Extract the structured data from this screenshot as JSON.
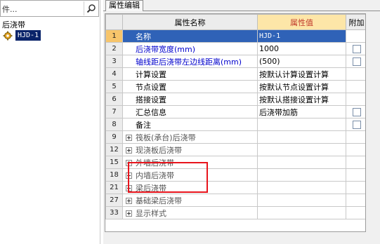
{
  "left": {
    "search_placeholder": "件...",
    "tree_root": "后浇带",
    "tree_child": "HJD-1"
  },
  "right": {
    "tab_label": "属性编辑",
    "headers": {
      "name": "属性名称",
      "value": "属性值",
      "extra": "附加"
    },
    "rows": [
      {
        "num": "1",
        "name": "名称",
        "value": "HJD-1",
        "extra": ""
      },
      {
        "num": "2",
        "name": "后浇带宽度(mm)",
        "value": "1000",
        "extra": "checkbox"
      },
      {
        "num": "3",
        "name": "轴线距后浇带左边线距离(mm)",
        "value": "(500)",
        "extra": "checkbox"
      },
      {
        "num": "4",
        "name": "计算设置",
        "value": "按默认计算设置计算",
        "extra": ""
      },
      {
        "num": "5",
        "name": "节点设置",
        "value": "按默认节点设置计算",
        "extra": ""
      },
      {
        "num": "6",
        "name": "搭接设置",
        "value": "按默认搭接设置计算",
        "extra": ""
      },
      {
        "num": "7",
        "name": "汇总信息",
        "value": "后浇带加筋",
        "extra": "checkbox"
      },
      {
        "num": "8",
        "name": "备注",
        "value": "",
        "extra": "checkbox"
      },
      {
        "num": "9",
        "name": "筏板(承台)后浇带",
        "value": "",
        "extra": ""
      },
      {
        "num": "12",
        "name": "现浇板后浇带",
        "value": "",
        "extra": ""
      },
      {
        "num": "15",
        "name": "外墙后浇带",
        "value": "",
        "extra": ""
      },
      {
        "num": "18",
        "name": "内墙后浇带",
        "value": "",
        "extra": ""
      },
      {
        "num": "21",
        "name": "梁后浇带",
        "value": "",
        "extra": ""
      },
      {
        "num": "27",
        "name": "基础梁后浇带",
        "value": "",
        "extra": ""
      },
      {
        "num": "33",
        "name": "显示样式",
        "value": "",
        "extra": ""
      }
    ]
  },
  "colors": {
    "selection": "#2f62b7",
    "highlight_box": "#e8141c",
    "value_header_bg": "#fde6a8",
    "active_row_num": "#f7c56b"
  }
}
